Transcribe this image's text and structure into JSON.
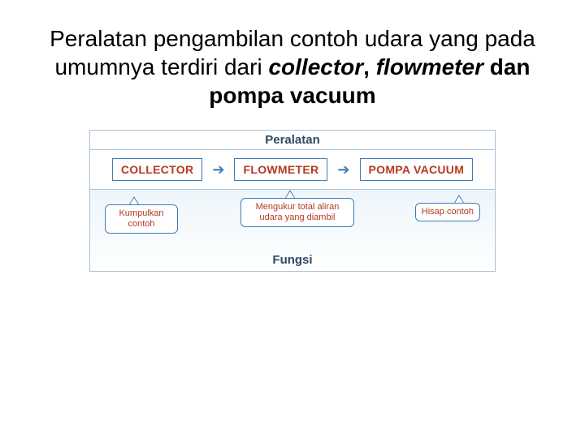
{
  "title": {
    "plain1": "Peralatan pengambilan contoh udara yang pada umumnya terdiri dari ",
    "italic1": "collector",
    "plain2": ", ",
    "italic2": "flowmeter",
    "plain3": " dan ",
    "bold1": "pompa vacuum"
  },
  "diagram": {
    "topLabel": "Peralatan",
    "bottomLabel": "Fungsi",
    "nodes": {
      "collector": "COLLECTOR",
      "flowmeter": "FLOWMETER",
      "pompa": "POMPA VACUUM"
    },
    "callouts": {
      "c1": "Kumpulkan contoh",
      "c2": "Mengukur total aliran udara yang diambil",
      "c3": "Hisap contoh"
    },
    "arrow": "➔"
  }
}
